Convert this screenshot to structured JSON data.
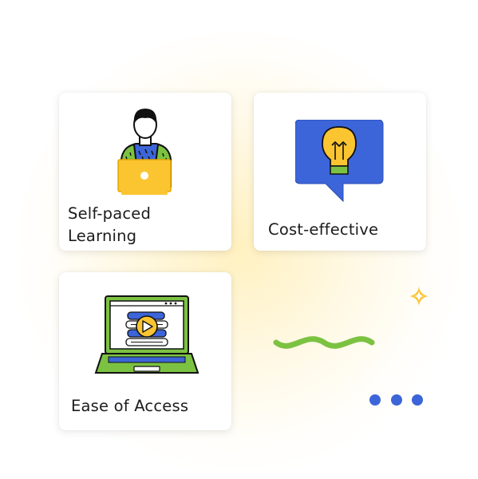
{
  "cards": [
    {
      "label": "Self-paced Learning",
      "icon": "person-laptop-icon"
    },
    {
      "label": "Cost-effective",
      "icon": "lightbulb-speech-bubble-icon"
    },
    {
      "label": "Ease of Access",
      "icon": "laptop-video-icon"
    }
  ],
  "decorations": [
    "sparkle-icon",
    "squiggle-icon",
    "dots-icon"
  ],
  "colors": {
    "blue": "#3c65d9",
    "yellow": "#fbc531",
    "green": "#7cc242",
    "glow": "#fff0bf"
  }
}
